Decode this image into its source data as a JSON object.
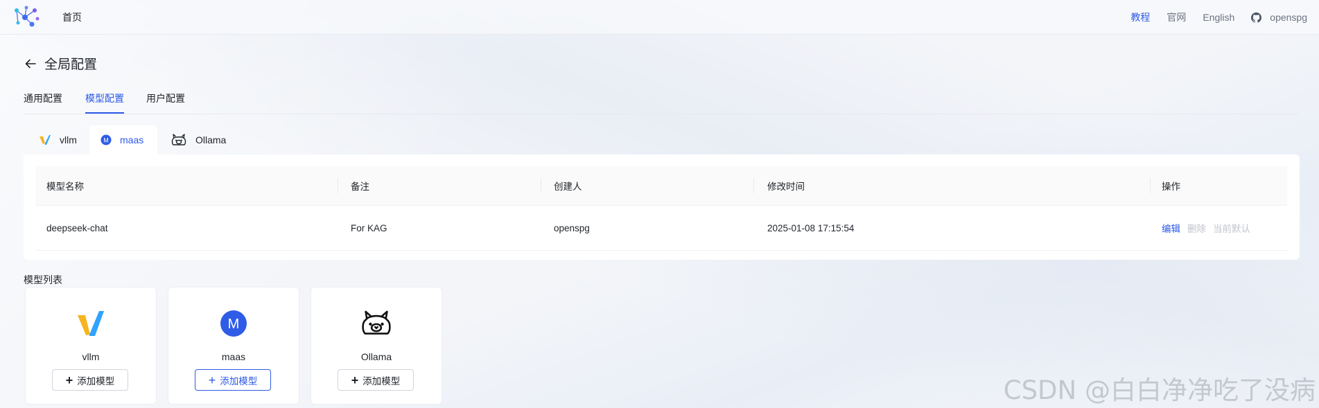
{
  "header": {
    "home": "首页",
    "links": [
      "教程",
      "官网",
      "English"
    ],
    "github_label": "openspg"
  },
  "page": {
    "title": "全局配置",
    "tabs": [
      "通用配置",
      "模型配置",
      "用户配置"
    ]
  },
  "provider_tabs": [
    "vllm",
    "maas",
    "Ollama"
  ],
  "table": {
    "columns": [
      "模型名称",
      "备注",
      "创建人",
      "修改时间",
      "操作"
    ],
    "rows": [
      {
        "name": "deepseek-chat",
        "note": "For KAG",
        "creator": "openspg",
        "modified": "2025-01-08 17:15:54",
        "actions": [
          "编辑",
          "删除",
          "当前默认"
        ]
      }
    ]
  },
  "model_list": {
    "label": "模型列表",
    "cards": [
      {
        "name": "vllm",
        "button": "添加模型"
      },
      {
        "name": "maas",
        "button": "添加模型",
        "logo_letter": "M"
      },
      {
        "name": "Ollama",
        "button": "添加模型"
      }
    ]
  },
  "colors": {
    "accent": "#2c59e8",
    "disabled": "#c0c4cc"
  },
  "watermark": "CSDN @白白净净吃了没病"
}
